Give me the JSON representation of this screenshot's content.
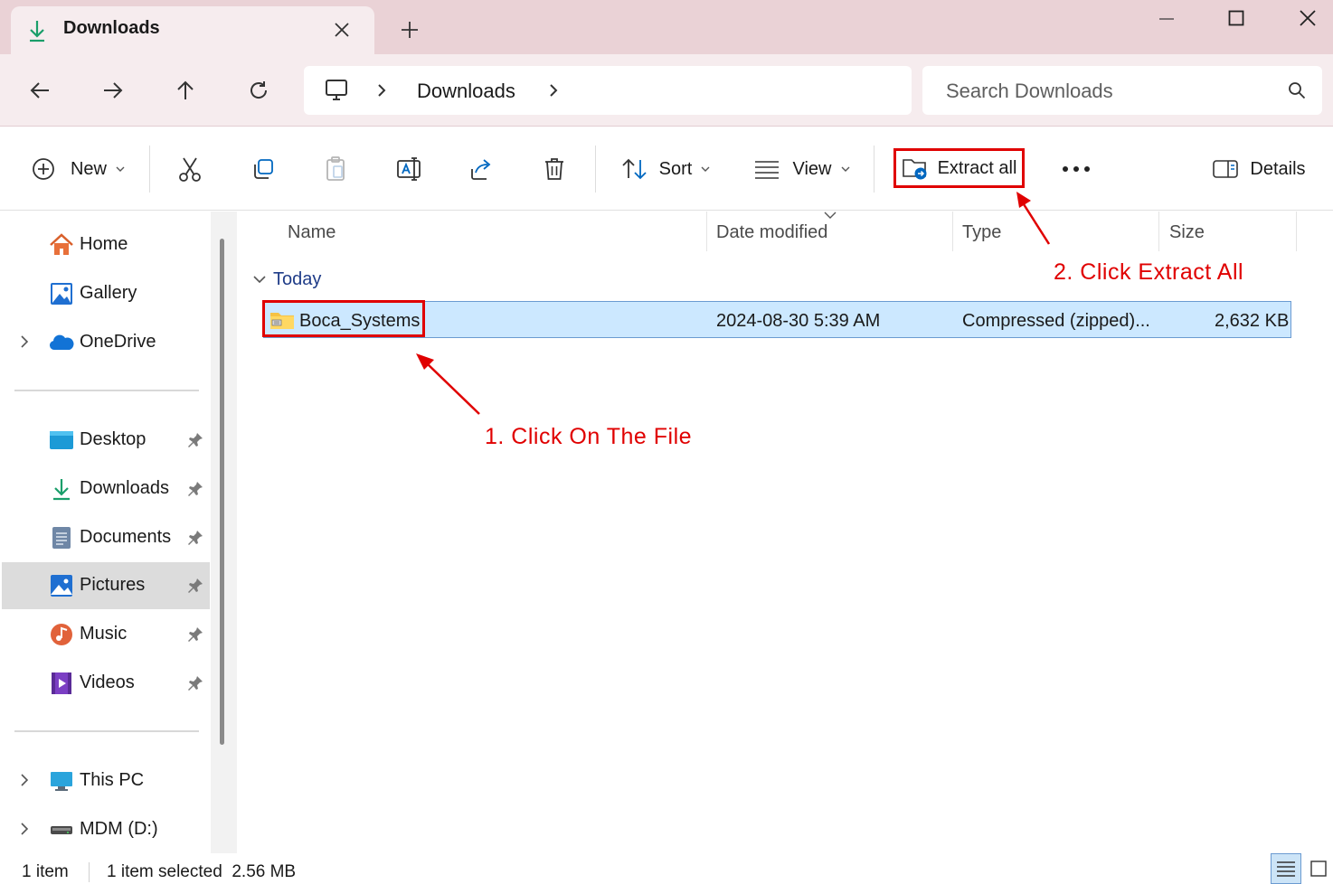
{
  "window": {
    "tab_title": "Downloads"
  },
  "address_bar": {
    "breadcrumb": "Downloads",
    "search_placeholder": "Search Downloads"
  },
  "command_bar": {
    "new_label": "New",
    "sort_label": "Sort",
    "view_label": "View",
    "extract_label": "Extract all",
    "details_label": "Details"
  },
  "sidebar": {
    "items": [
      {
        "label": "Home",
        "icon": "home-icon"
      },
      {
        "label": "Gallery",
        "icon": "gallery-icon"
      },
      {
        "label": "OneDrive",
        "icon": "onedrive-icon"
      },
      {
        "label": "Desktop",
        "icon": "desktop-folder-icon"
      },
      {
        "label": "Downloads",
        "icon": "downloads-icon"
      },
      {
        "label": "Documents",
        "icon": "documents-icon"
      },
      {
        "label": "Pictures",
        "icon": "pictures-icon"
      },
      {
        "label": "Music",
        "icon": "music-icon"
      },
      {
        "label": "Videos",
        "icon": "videos-icon"
      },
      {
        "label": "This PC",
        "icon": "this-pc-icon"
      },
      {
        "label": "MDM (D:)",
        "icon": "drive-icon"
      }
    ],
    "selected": "Pictures"
  },
  "file_list": {
    "columns": [
      "Name",
      "Date modified",
      "Type",
      "Size"
    ],
    "group": "Today",
    "rows": [
      {
        "name": "Boca_Systems",
        "date": "2024-08-30 5:39 AM",
        "type": "Compressed (zipped)...",
        "size": "2,632 KB"
      }
    ]
  },
  "annotations": {
    "step1": "1. Click On The File",
    "step2": "2. Click Extract All",
    "color": "#e00000"
  },
  "status_bar": {
    "item_count": "1 item",
    "selection": "1 item selected  2.56 MB"
  },
  "colors": {
    "tabstrip": "#ead2d6",
    "selected_row": "#cce8ff",
    "accent": "#0067c0"
  }
}
